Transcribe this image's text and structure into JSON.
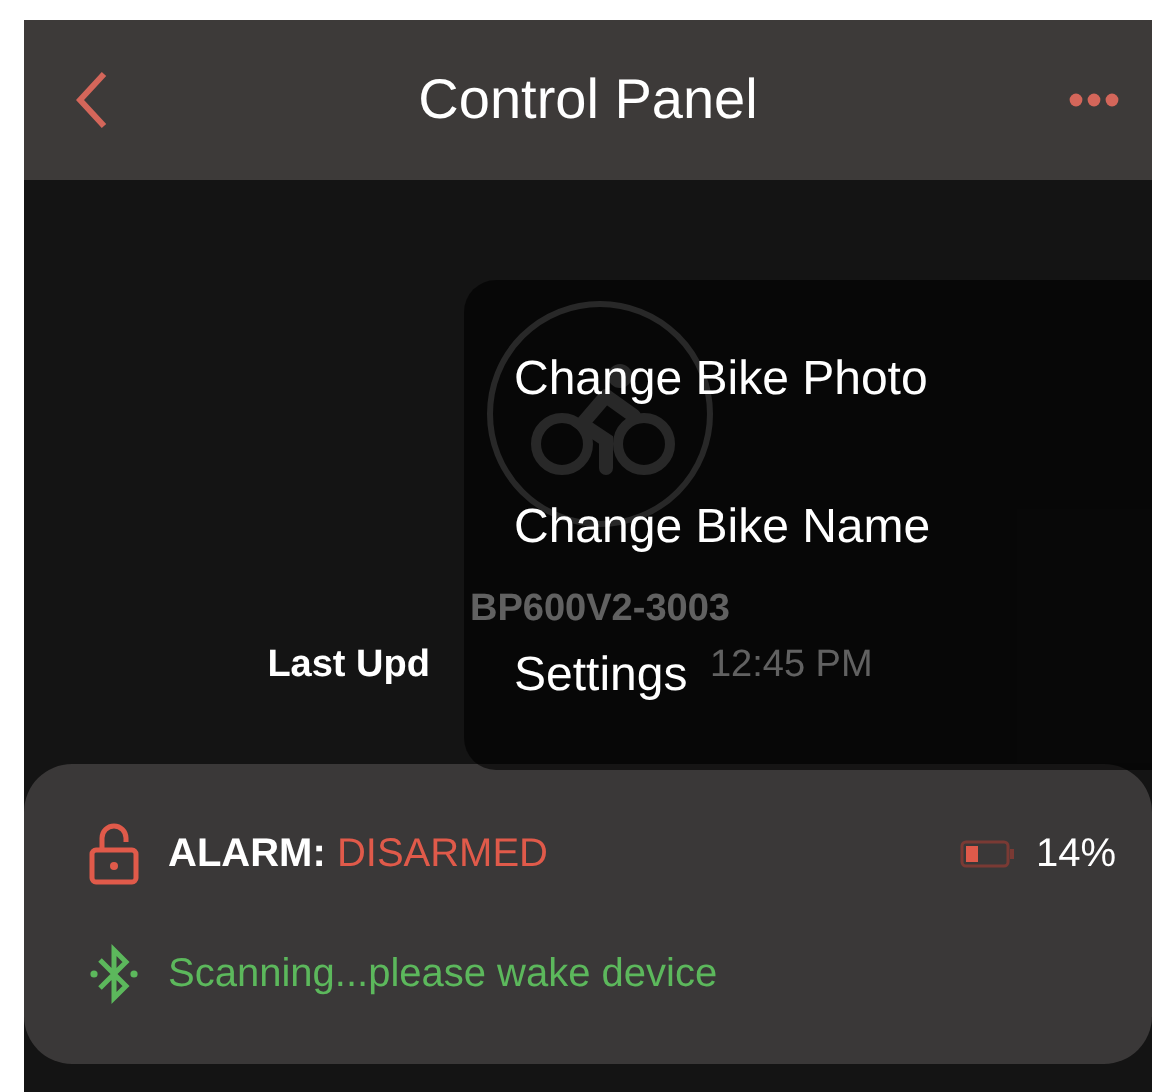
{
  "header": {
    "title": "Control Panel"
  },
  "bike": {
    "name": "BP600V2-3003",
    "last_updated_start": "Last Upd",
    "last_updated_end": "12:45 PM"
  },
  "menu": {
    "items": [
      {
        "label": "Change Bike Photo"
      },
      {
        "label": "Change Bike Name"
      },
      {
        "label": "Settings"
      }
    ]
  },
  "status": {
    "alarm_label": "ALARM:",
    "alarm_value": "DISARMED",
    "battery": "14%",
    "connection": "Scanning...please wake device"
  }
}
